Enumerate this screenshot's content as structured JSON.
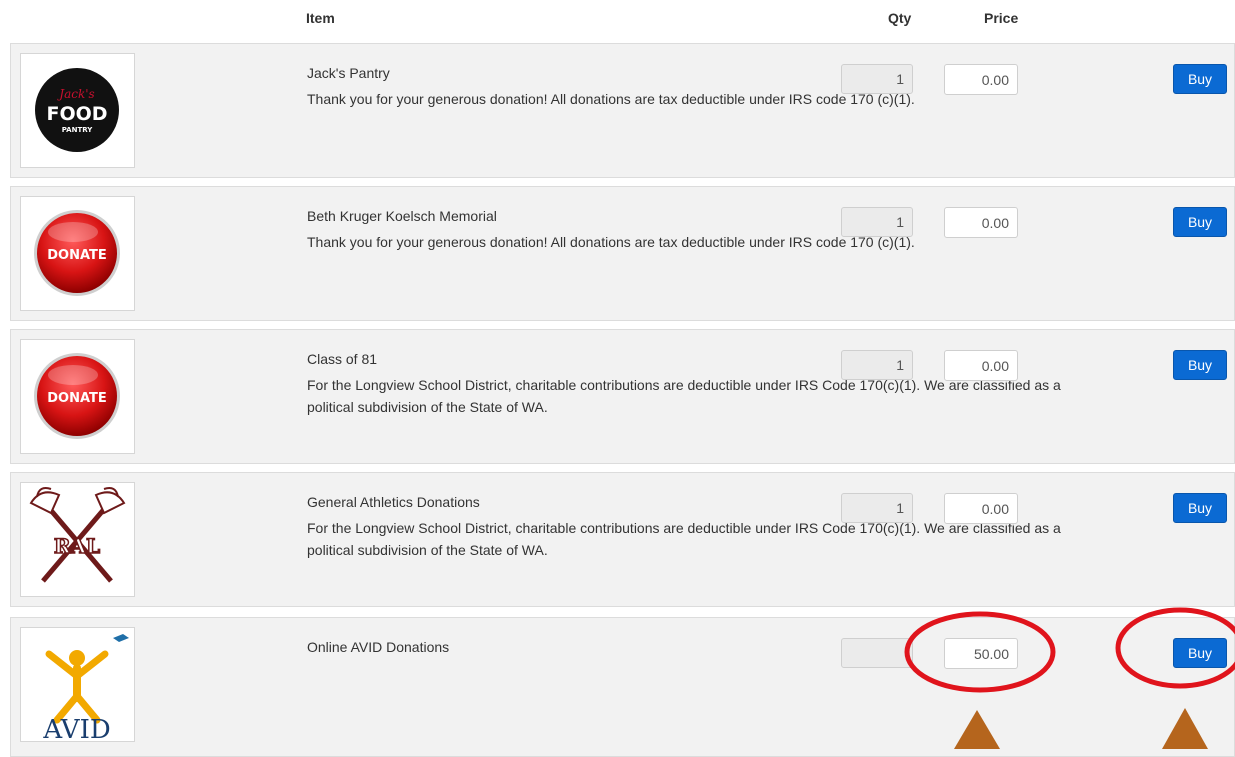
{
  "header": {
    "item": "Item",
    "qty": "Qty",
    "price": "Price"
  },
  "items": [
    {
      "title": "Jack's Pantry",
      "description": "Thank you for your generous donation! All donations are tax deductible under IRS code 170 (c)(1).",
      "qty": "1",
      "price": "0.00",
      "buy_label": "Buy",
      "logo": {
        "icon": "food-pantry-logo",
        "script_text": "Jack's",
        "main_text": "FOOD",
        "sub_text": "PANTRY"
      }
    },
    {
      "title": "Beth Kruger Koelsch Memorial",
      "description": "Thank you for your generous donation! All donations are tax deductible under IRS code 170 (c)(1).",
      "qty": "1",
      "price": "0.00",
      "buy_label": "Buy",
      "logo": {
        "icon": "donate-button-image",
        "text": "DONATE"
      }
    },
    {
      "title": "Class of 81",
      "description": "For the Longview School District, charitable contributions are deductible under IRS Code 170(c)(1). We are classified as a political subdivision of the State of WA.",
      "qty": "1",
      "price": "0.00",
      "buy_label": "Buy",
      "logo": {
        "icon": "donate-button-image",
        "text": "DONATE"
      }
    },
    {
      "title": "General Athletics Donations",
      "description": "For the Longview School District, charitable contributions are deductible under IRS Code 170(c)(1). We are classified as a political subdivision of the State of WA.",
      "qty": "1",
      "price": "0.00",
      "buy_label": "Buy",
      "logo": {
        "icon": "ral-crossed-axes-logo",
        "text": "RAL"
      }
    },
    {
      "title": "Online AVID Donations",
      "description": "",
      "qty": "",
      "price": "50.00",
      "buy_label": "Buy",
      "logo": {
        "icon": "avid-logo",
        "text": "AVID"
      }
    }
  ],
  "colors": {
    "buy_button": "#0b6ad3",
    "row_background": "#f2f2f2",
    "annotation_circle": "#e0141c",
    "annotation_arrow": "#b5651d"
  }
}
